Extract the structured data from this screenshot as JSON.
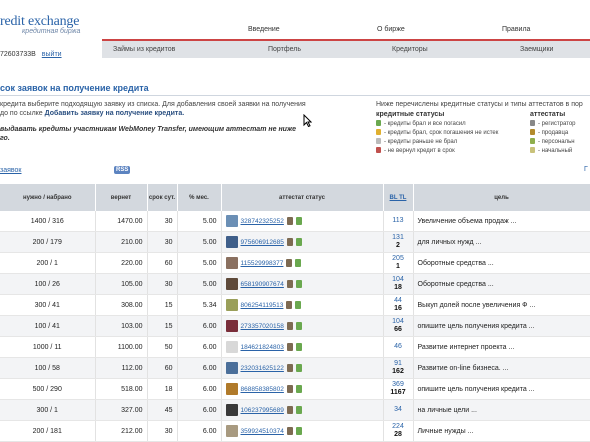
{
  "brand": {
    "name": "redit exchange",
    "sub": "кредитная биржа"
  },
  "user": {
    "id": "72603733В",
    "logout": "выйти"
  },
  "topnav": [
    "Введение",
    "О бирже",
    "Правила"
  ],
  "subnav": [
    "Займы из кредитов",
    "Портфель",
    "Кредиторы",
    "Заемщики"
  ],
  "page": {
    "title": "сок заявок на получение кредита",
    "intro1": "кредита выберите подходящую заявку из списка. Для добавления своей заявки на получения",
    "intro2_pre": "до по ссылке ",
    "intro2_link": "Добавить заявку на получение кредита.",
    "warn": "выдавать кредиты участникам WebMoney Transfer, имеющим аттестат не ниже",
    "warn2": "го."
  },
  "legend": {
    "note": "Ниже перечислены кредитные статусы и типы аттестатов в пор",
    "col1_title": "кредитные статусы",
    "col1": [
      "- кредиты брал и все погасил",
      "- кредиты брал, срок погашения не истек",
      "- кредиты раньше не брал",
      "- не вернул кредит в срок"
    ],
    "col1_colors": [
      "#6aa84f",
      "#e0b030",
      "#bbbbbb",
      "#c0504d"
    ],
    "col2_title": "аттестаты",
    "col2": [
      "- регистратор",
      "- продавца",
      "- персональн",
      "- начальный"
    ],
    "col2_colors": [
      "#888",
      "#b38b2c",
      "#8fae4c",
      "#c9c27a"
    ]
  },
  "toolbar": {
    "list_link": "заявок",
    "rss": "RSS",
    "right": "Г"
  },
  "table": {
    "headers": [
      "нужно / набрано",
      "вернет",
      "срок сут.",
      "% мес.",
      "аттестат статус",
      "BL TL",
      "цель"
    ],
    "rows": [
      {
        "need": "1400 / 316",
        "ret": "1470.00",
        "term": "30",
        "pct": "5.00",
        "wmid": "328742325252",
        "bl": "113",
        "tl": "",
        "goal": "Увеличение объема продаж ..."
      },
      {
        "need": "200 / 179",
        "ret": "210.00",
        "term": "30",
        "pct": "5.00",
        "wmid": "975606912685",
        "bl": "131",
        "tl": "2",
        "goal": "для личных нужд ..."
      },
      {
        "need": "200 / 1",
        "ret": "220.00",
        "term": "60",
        "pct": "5.00",
        "wmid": "115529998377",
        "bl": "205",
        "tl": "1",
        "goal": "Оборотные средства ..."
      },
      {
        "need": "100 / 26",
        "ret": "105.00",
        "term": "30",
        "pct": "5.00",
        "wmid": "658190907674",
        "bl": "104",
        "tl": "18",
        "goal": "Оборотные средства ..."
      },
      {
        "need": "300 / 41",
        "ret": "308.00",
        "term": "15",
        "pct": "5.34",
        "wmid": "806254119513",
        "bl": "44",
        "tl": "16",
        "goal": "Выкуп долей после увеличения Ф ..."
      },
      {
        "need": "100 / 41",
        "ret": "103.00",
        "term": "15",
        "pct": "6.00",
        "wmid": "273357020158",
        "bl": "104",
        "tl": "66",
        "goal": "опишите цель получения кредита ..."
      },
      {
        "need": "1000 / 11",
        "ret": "1100.00",
        "term": "50",
        "pct": "6.00",
        "wmid": "184621824803",
        "bl": "46",
        "tl": "",
        "goal": "Развитие интернет проекта ..."
      },
      {
        "need": "100 / 58",
        "ret": "112.00",
        "term": "60",
        "pct": "6.00",
        "wmid": "232031625122",
        "bl": "91",
        "tl": "162",
        "goal": "Развитие on-line бизнеса. ..."
      },
      {
        "need": "500 / 290",
        "ret": "518.00",
        "term": "18",
        "pct": "6.00",
        "wmid": "868858385802",
        "bl": "369",
        "tl": "1167",
        "goal": "опишите цель получения кредита ..."
      },
      {
        "need": "300 / 1",
        "ret": "327.00",
        "term": "45",
        "pct": "6.00",
        "wmid": "106237995689",
        "bl": "34",
        "tl": "",
        "goal": "на личные цели ..."
      },
      {
        "need": "200 / 181",
        "ret": "212.00",
        "term": "30",
        "pct": "6.00",
        "wmid": "359924510374",
        "bl": "224",
        "tl": "28",
        "goal": "Личные нужды ..."
      }
    ],
    "avatar_colors": [
      "#6b8fb5",
      "#3f5f8a",
      "#8a7060",
      "#5f4a3a",
      "#9a9f5a",
      "#7a2e3a",
      "#d8d8d8",
      "#4b6f9a",
      "#b07a2a",
      "#3a3a3a",
      "#a89a80"
    ]
  }
}
